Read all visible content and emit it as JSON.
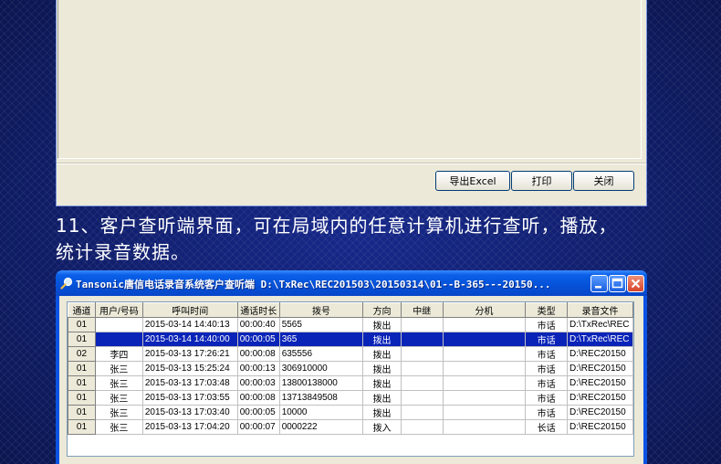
{
  "top_dialog": {
    "export_label": "导出Excel",
    "print_label": "打印",
    "close_label": "关闭"
  },
  "caption": {
    "line1": "11、客户查听端界面，可在局域内的任意计算机进行查听，播放，",
    "line2": "统计录音数据。"
  },
  "window": {
    "title": "Tansonic唐信电话录音系统客户查听端  D:\\TxRec\\REC201503\\20150314\\01--B-365---20150...",
    "icon": "magnifier-icon"
  },
  "table": {
    "columns": [
      "通道",
      "用户/号码",
      "呼叫时间",
      "通话时长",
      "拨号",
      "方向",
      "中继",
      "分机",
      "类型",
      "录音文件"
    ],
    "rows": [
      [
        "01",
        "",
        "2015-03-14 14:40:13",
        "00:00:40",
        "5565",
        "拨出",
        "",
        "",
        "市话",
        "D:\\TxRec\\REC"
      ],
      [
        "01",
        "",
        "2015-03-14 14:40:00",
        "00:00:05",
        "365",
        "拨出",
        "",
        "",
        "市话",
        "D:\\TxRec\\REC"
      ],
      [
        "02",
        "李四",
        "2015-03-13 17:26:21",
        "00:00:08",
        "635556",
        "拨出",
        "",
        "",
        "市话",
        "D:\\REC20150"
      ],
      [
        "01",
        "张三",
        "2015-03-13 15:25:24",
        "00:00:13",
        "306910000",
        "拨出",
        "",
        "",
        "市话",
        "D:\\REC20150"
      ],
      [
        "01",
        "张三",
        "2015-03-13 17:03:48",
        "00:00:03",
        "13800138000",
        "拨出",
        "",
        "",
        "市话",
        "D:\\REC20150"
      ],
      [
        "01",
        "张三",
        "2015-03-13 17:03:55",
        "00:00:08",
        "13713849508",
        "拨出",
        "",
        "",
        "市话",
        "D:\\REC20150"
      ],
      [
        "01",
        "张三",
        "2015-03-13 17:03:40",
        "00:00:05",
        "10000",
        "拨出",
        "",
        "",
        "市话",
        "D:\\REC20150"
      ],
      [
        "01",
        "张三",
        "2015-03-13 17:04:20",
        "00:00:07",
        "0000222",
        "拨入",
        "",
        "",
        "长话",
        "D:\\REC20150"
      ]
    ],
    "selected_row": 1
  },
  "colors": {
    "selection": "#0a24b8",
    "titlebar": "#0551d8",
    "background": "#0d1b5e"
  }
}
